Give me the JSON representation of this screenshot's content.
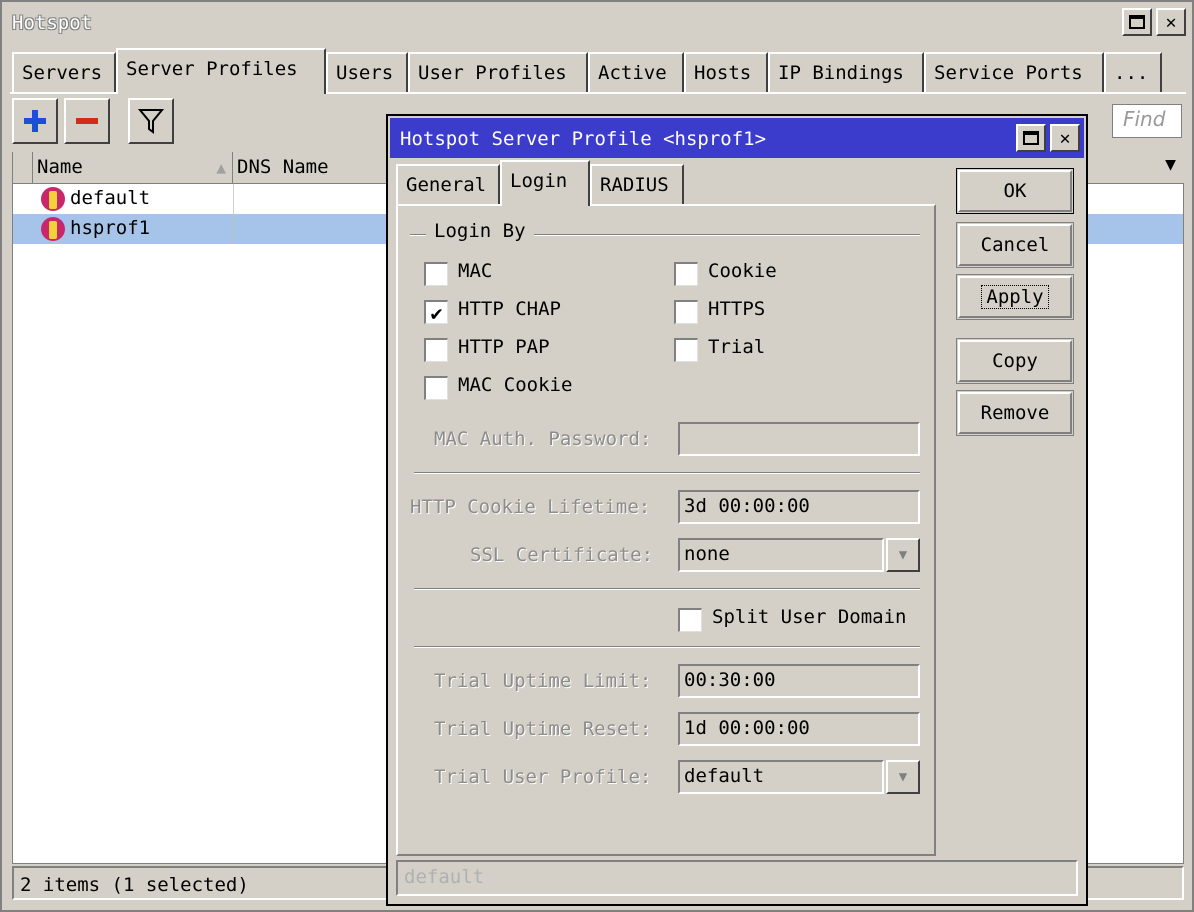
{
  "window": {
    "title": "Hotspot"
  },
  "tabs": [
    {
      "label": "Servers"
    },
    {
      "label": "Server Profiles"
    },
    {
      "label": "Users"
    },
    {
      "label": "User Profiles"
    },
    {
      "label": "Active"
    },
    {
      "label": "Hosts"
    },
    {
      "label": "IP Bindings"
    },
    {
      "label": "Service Ports"
    },
    {
      "label": "..."
    }
  ],
  "toolbar": {
    "find_placeholder": "Find"
  },
  "list": {
    "columns": [
      "Name",
      "DNS Name"
    ],
    "rows": [
      {
        "name": "default",
        "dns_name": "",
        "selected": false
      },
      {
        "name": "hsprof1",
        "dns_name": "",
        "selected": true
      }
    ]
  },
  "status": {
    "text": "2 items (1 selected)"
  },
  "dialog": {
    "title": "Hotspot Server Profile <hsprof1>",
    "tabs": [
      "General",
      "Login",
      "RADIUS"
    ],
    "active_tab": "Login",
    "login_by_label": "Login By",
    "login_by": [
      {
        "label": "MAC",
        "checked": false
      },
      {
        "label": "Cookie",
        "checked": false
      },
      {
        "label": "HTTP CHAP",
        "checked": true
      },
      {
        "label": "HTTPS",
        "checked": false
      },
      {
        "label": "HTTP PAP",
        "checked": false
      },
      {
        "label": "Trial",
        "checked": false
      },
      {
        "label": "MAC Cookie",
        "checked": false
      }
    ],
    "mac_auth_password_label": "MAC Auth. Password:",
    "mac_auth_password": "",
    "http_cookie_lifetime_label": "HTTP Cookie Lifetime:",
    "http_cookie_lifetime": "3d 00:00:00",
    "ssl_certificate_label": "SSL Certificate:",
    "ssl_certificate": "none",
    "split_user_domain_label": "Split User Domain",
    "split_user_domain": false,
    "trial_uptime_limit_label": "Trial Uptime Limit:",
    "trial_uptime_limit": "00:30:00",
    "trial_uptime_reset_label": "Trial Uptime Reset:",
    "trial_uptime_reset": "1d 00:00:00",
    "trial_user_profile_label": "Trial User Profile:",
    "trial_user_profile": "default",
    "buttons": {
      "ok": "OK",
      "cancel": "Cancel",
      "apply": "Apply",
      "copy": "Copy",
      "remove": "Remove"
    },
    "status_text": "default"
  },
  "colors": {
    "dialog_titlebar": "#3c3ccc",
    "selection": "#a6c4ea",
    "add_icon": "#1a4fd6",
    "remove_icon": "#d42a1a"
  },
  "icons": {
    "add": "plus-icon",
    "remove": "minus-icon",
    "filter": "funnel-icon",
    "row": "hotspot-profile-icon"
  }
}
